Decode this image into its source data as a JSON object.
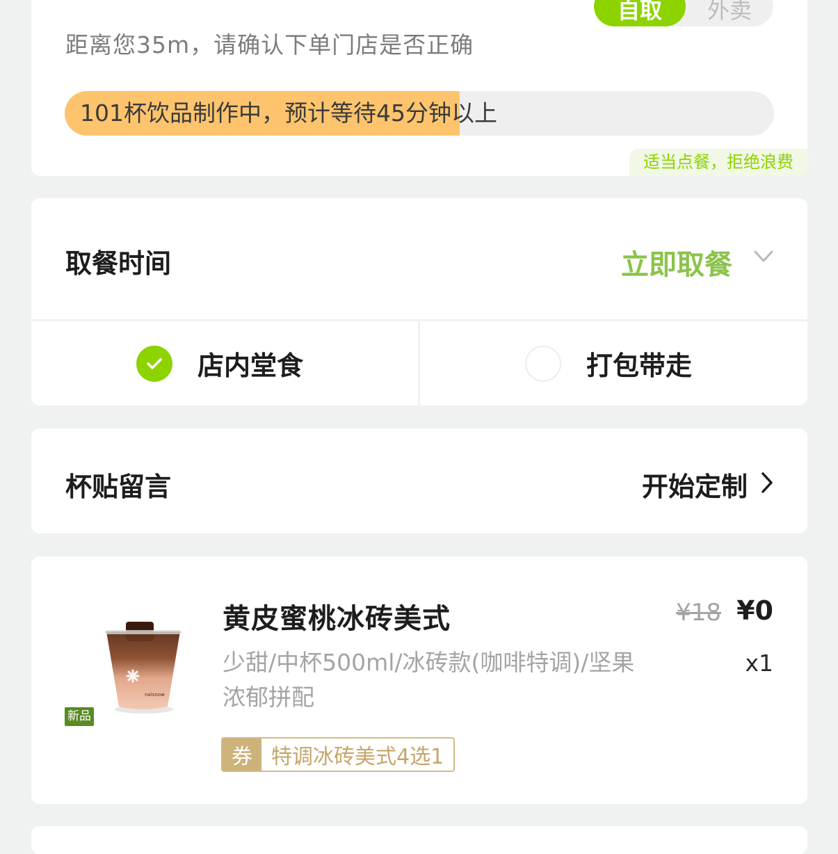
{
  "store": {
    "mode_pickup": "自取",
    "mode_delivery": "外卖",
    "distance_text": "距离您35m，请确认下单门店是否正确",
    "queue_text": "101杯饮品制作中，预计等待45分钟以上",
    "queue_progress": 0.557,
    "waste_tip": "适当点餐，拒绝浪费"
  },
  "pickup": {
    "title": "取餐时间",
    "value": "立即取餐",
    "options": [
      {
        "label": "店内堂食",
        "selected": true
      },
      {
        "label": "打包带走",
        "selected": false
      }
    ]
  },
  "note": {
    "title": "杯贴留言",
    "action": "开始定制"
  },
  "product": {
    "name": "黄皮蜜桃冰砖美式",
    "spec": "少甜/中杯500ml/冰砖款(咖啡特调)/坚果浓郁拼配",
    "badge": "新品",
    "price_original": "¥18",
    "price_final": "¥0",
    "quantity": "x1",
    "coupon_tag": "券",
    "coupon_text": "特调冰砖美式4选1",
    "cup_brand": "naisnow"
  },
  "colors": {
    "accent_green": "#8cd300",
    "progress_orange": "#fdc46d",
    "coupon_gold": "#cdb27a"
  },
  "icons": [
    "check-icon",
    "chevron-down-icon",
    "chevron-right-icon"
  ]
}
